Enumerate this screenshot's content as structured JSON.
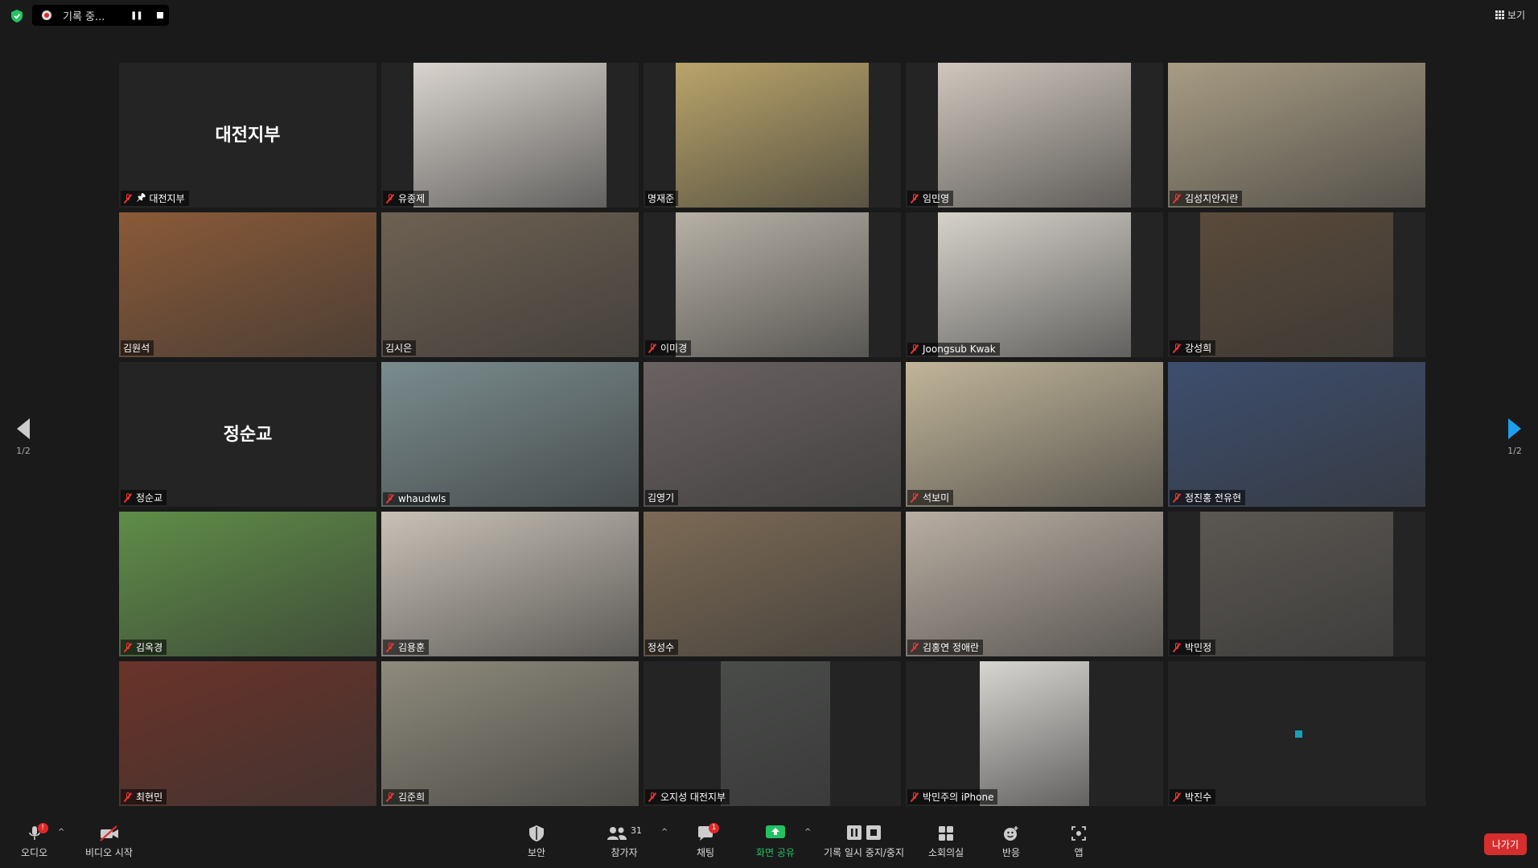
{
  "recording": {
    "label": "기록 중..."
  },
  "view_label": "보기",
  "pager": {
    "left_label": "1/2",
    "right_label": "1/2"
  },
  "participants": [
    {
      "name": "대전지부",
      "muted": true,
      "pinned": true,
      "video": false,
      "display_name": "대전지부"
    },
    {
      "name": "유종제",
      "muted": true,
      "video": true,
      "bg": "#d9d4ce"
    },
    {
      "name": "명재준",
      "muted": false,
      "video": true,
      "bg": "#b9a46a"
    },
    {
      "name": "임민영",
      "muted": true,
      "video": true,
      "bg": "#cfc7bd"
    },
    {
      "name": "김성지안지란",
      "muted": true,
      "video": true,
      "bg": "#a89c84"
    },
    {
      "name": "김원석",
      "muted": false,
      "video": true,
      "bg": "#8a5a38"
    },
    {
      "name": "김시은",
      "muted": false,
      "video": true,
      "bg": "#6e6152"
    },
    {
      "name": "이미경",
      "muted": true,
      "video": true,
      "bg": "#b7b1a6"
    },
    {
      "name": "Joongsub Kwak",
      "muted": true,
      "video": true,
      "bg": "#d6d2cb"
    },
    {
      "name": "강성희",
      "muted": true,
      "video": true,
      "bg": "#5a4a3a"
    },
    {
      "name": "정순교",
      "muted": true,
      "video": false,
      "display_name": "정순교"
    },
    {
      "name": "whaudwls",
      "muted": true,
      "video": true,
      "bg": "#7a8c8e"
    },
    {
      "name": "김영기",
      "muted": false,
      "video": true,
      "bg": "#6b6262"
    },
    {
      "name": "석보미",
      "muted": true,
      "video": true,
      "bg": "#c1b59a"
    },
    {
      "name": "정진홍 전유현",
      "muted": true,
      "video": true,
      "bg": "#3d4e6e"
    },
    {
      "name": "김옥경",
      "muted": true,
      "video": true,
      "bg": "#5f8d48"
    },
    {
      "name": "김용훈",
      "muted": true,
      "video": true,
      "bg": "#c8c1b6"
    },
    {
      "name": "정성수",
      "muted": false,
      "video": true,
      "bg": "#7c6a55",
      "active": true
    },
    {
      "name": "김홍연 정애란",
      "muted": true,
      "video": true,
      "bg": "#b9aea2"
    },
    {
      "name": "박민정",
      "muted": true,
      "video": true,
      "bg": "#5b5752"
    },
    {
      "name": "최현민",
      "muted": true,
      "video": true,
      "bg": "#6a3329"
    },
    {
      "name": "김준희",
      "muted": true,
      "video": true,
      "bg": "#8e8a7c"
    },
    {
      "name": "오지성 대전지부",
      "muted": true,
      "video": true,
      "bg": "#4a4c4a"
    },
    {
      "name": "박민주의 iPhone",
      "muted": true,
      "video": true,
      "bg": "#d8d6d2"
    },
    {
      "name": "박진수",
      "muted": true,
      "video": false,
      "display_name": ""
    }
  ],
  "toolbar": {
    "audio": "오디오",
    "audio_badge": "!",
    "video": "비디오 시작",
    "security": "보안",
    "participants": "참가자",
    "participants_count": "31",
    "chat": "채팅",
    "chat_badge": "1",
    "share": "화면 공유",
    "record": "기록 일시 중지/중지",
    "breakout": "소회의실",
    "reactions": "반응",
    "apps": "앱",
    "leave": "나가기"
  },
  "colors": {
    "share_green": "#23c160",
    "leave_red": "#d62e2e",
    "active_outline": "#cde36a",
    "arrow_blue": "#1d9ff0"
  }
}
